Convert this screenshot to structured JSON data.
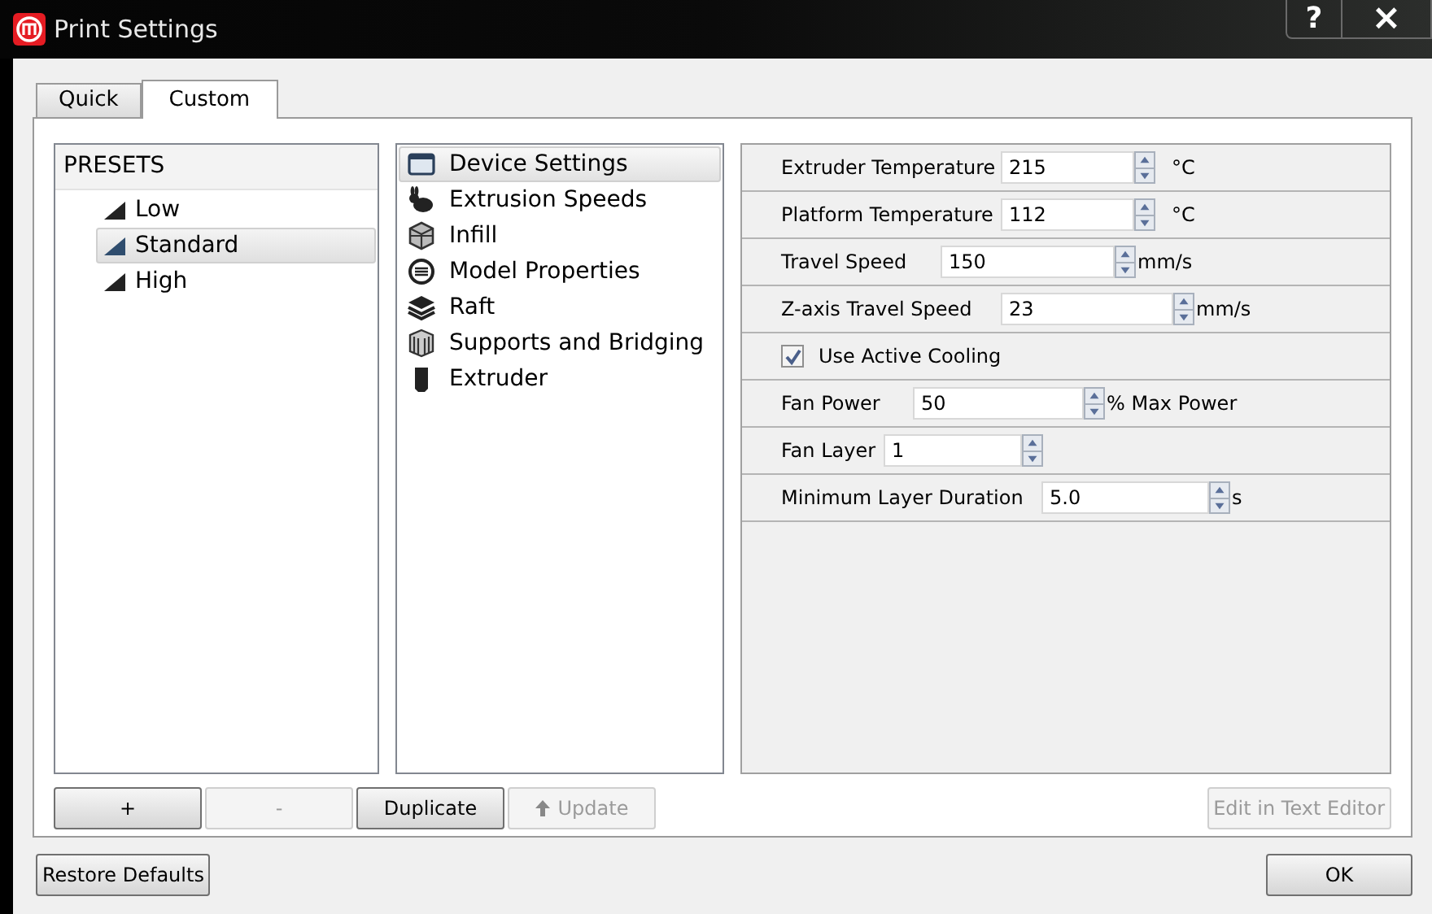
{
  "window": {
    "title": "Print Settings",
    "help": "?",
    "close": "×"
  },
  "tabs": [
    {
      "label": "Quick",
      "selected": false
    },
    {
      "label": "Custom",
      "selected": true
    }
  ],
  "presets": {
    "header": "PRESETS",
    "items": [
      {
        "label": "Low",
        "selected": false
      },
      {
        "label": "Standard",
        "selected": true
      },
      {
        "label": "High",
        "selected": false
      }
    ]
  },
  "categories": [
    {
      "label": "Device Settings",
      "kind": "window",
      "selected": true
    },
    {
      "label": "Extrusion Speeds",
      "kind": "rabbit",
      "selected": false
    },
    {
      "label": "Infill",
      "kind": "infill",
      "selected": false
    },
    {
      "label": "Model Properties",
      "kind": "model",
      "selected": false
    },
    {
      "label": "Raft",
      "kind": "raft",
      "selected": false
    },
    {
      "label": "Supports and Bridging",
      "kind": "supports",
      "selected": false
    },
    {
      "label": "Extruder",
      "kind": "extruder",
      "selected": false
    }
  ],
  "settings": [
    {
      "kind": "spin",
      "label": "Extruder Temperature",
      "value": "215",
      "unit": "°C"
    },
    {
      "kind": "spin",
      "label": "Platform Temperature",
      "value": "112",
      "unit": "°C"
    },
    {
      "kind": "spin",
      "label": "Travel Speed",
      "value": "150",
      "unit": "mm/s"
    },
    {
      "kind": "spin",
      "label": "Z-axis Travel Speed",
      "value": "23",
      "unit": "mm/s"
    },
    {
      "kind": "checkbox",
      "label": "Use Active Cooling",
      "checked": true
    },
    {
      "kind": "spin",
      "label": "Fan Power",
      "value": "50",
      "unit": "% Max Power"
    },
    {
      "kind": "spin",
      "label": "Fan Layer",
      "value": "1"
    },
    {
      "kind": "spin",
      "label": "Minimum Layer Duration",
      "value": "5.0",
      "unit": "s"
    }
  ],
  "preset_buttons": [
    {
      "label": "+",
      "disabled": false
    },
    {
      "label": "-",
      "disabled": true
    },
    {
      "label": "Duplicate",
      "disabled": false
    },
    {
      "label": "Update",
      "disabled": true
    }
  ],
  "edit_button": {
    "label": "Edit in Text Editor",
    "disabled": true
  },
  "footer": {
    "restore": "Restore Defaults",
    "ok": "OK"
  }
}
